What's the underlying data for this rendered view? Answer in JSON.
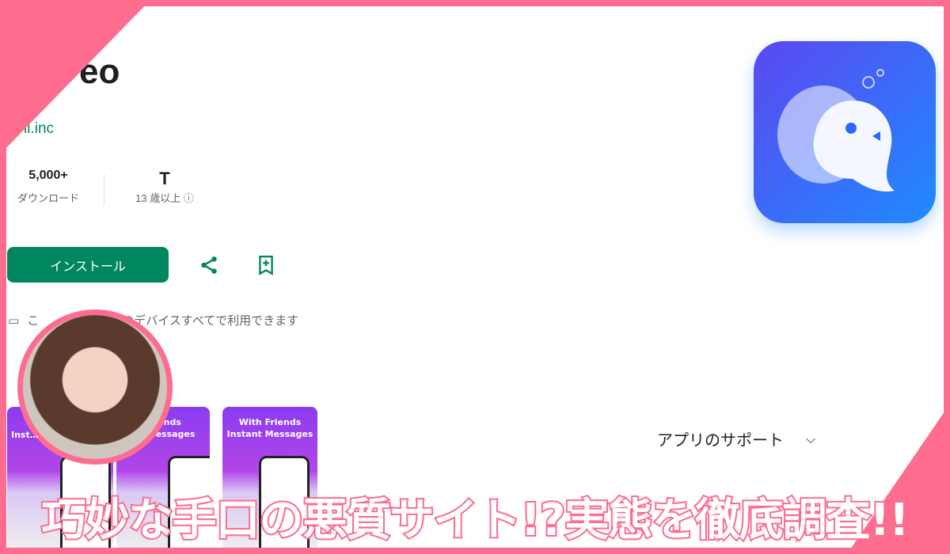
{
  "app": {
    "title": "eo",
    "developer": "ii.inc"
  },
  "stats": [
    {
      "value": "5,000+",
      "label": "ダウンロード"
    },
    {
      "value": "T",
      "label": "13 歳以上"
    }
  ],
  "actions": {
    "install_label": "インストール"
  },
  "devices_text": "こ　　　　お使いのデバイスすべてで利用できます",
  "screenshots": [
    {
      "text": "Inst…"
    },
    {
      "text": "Friends\n…t Messages"
    },
    {
      "text": "With Friends\nInstant Messages"
    }
  ],
  "support_label": "アプリのサポート",
  "banner": "巧妙な手口の悪質サイト!?実態を徹底調査!!",
  "colors": {
    "accent": "#01875f",
    "frame": "#fe6c8f",
    "icon": "#1e8bff"
  }
}
